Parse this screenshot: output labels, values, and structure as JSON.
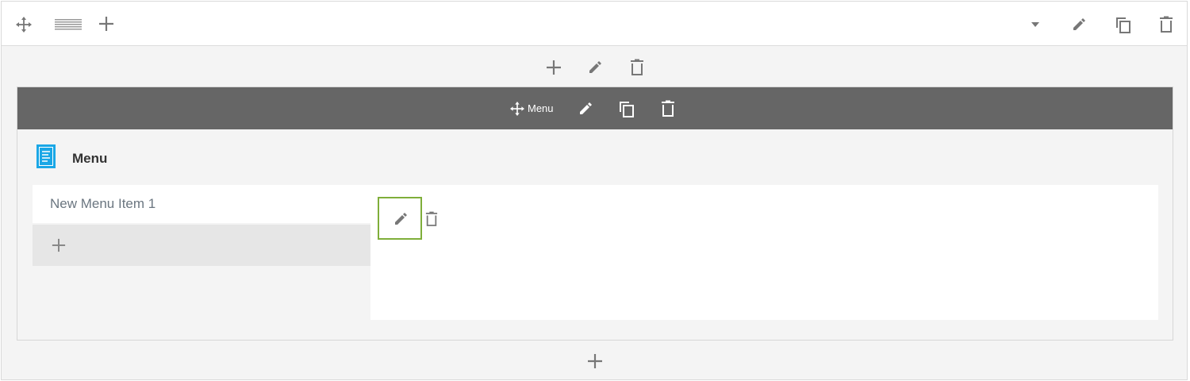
{
  "toolbar": {
    "icons": [
      "move-icon",
      "layout-columns-icon",
      "plus-icon",
      "caret-down-icon",
      "pencil-icon",
      "copy-icon",
      "trash-icon"
    ]
  },
  "row_actions": {
    "icons": [
      "plus-icon",
      "pencil-icon",
      "trash-icon"
    ]
  },
  "module": {
    "bar_label": "Menu",
    "heading": "Menu",
    "heading_icon": "document-icon",
    "accent_color": "#1aa7e6",
    "bar_color": "#666666"
  },
  "menu": {
    "items": [
      {
        "label": "New Menu Item 1"
      }
    ]
  },
  "editor": {
    "active_border_color": "#7fae3a"
  }
}
